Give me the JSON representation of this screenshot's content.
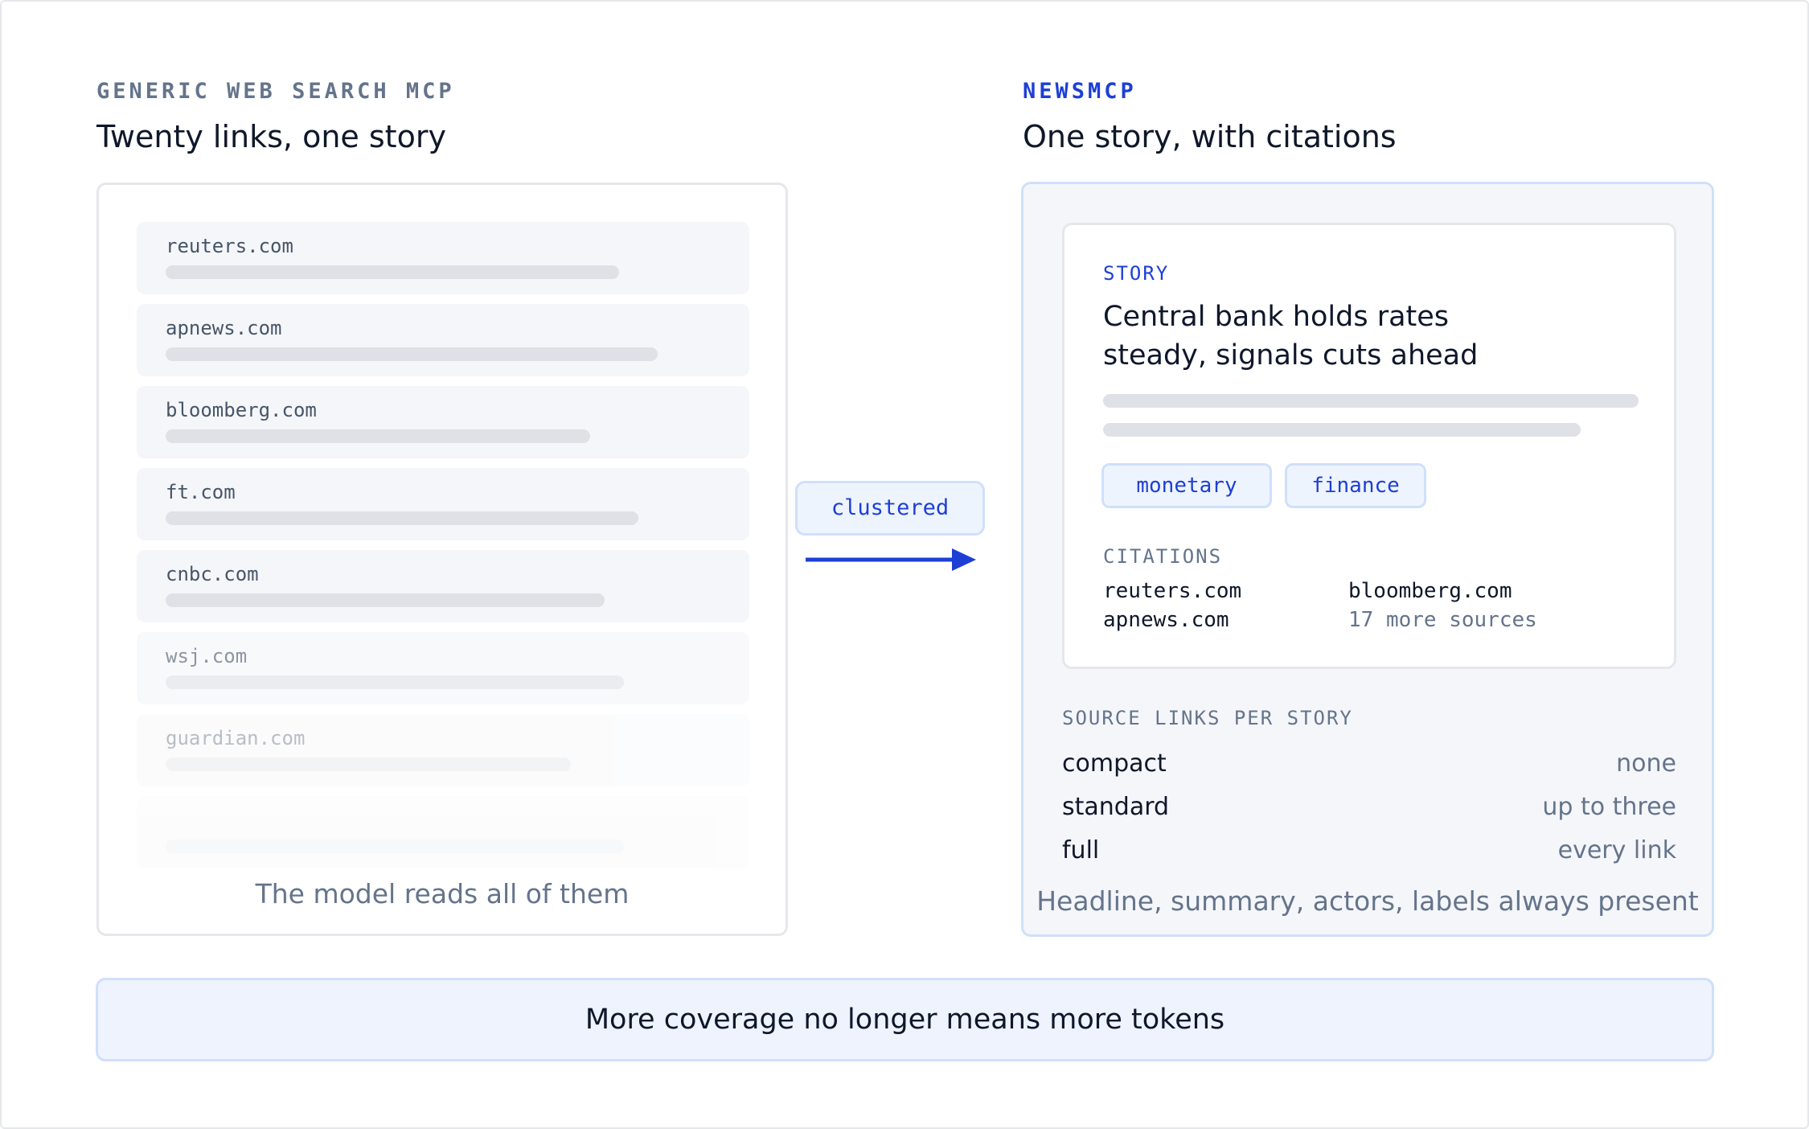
{
  "left": {
    "eyebrow": "GENERIC WEB SEARCH MCP",
    "heading": "Twenty links, one story",
    "results": [
      {
        "domain": "reuters.com"
      },
      {
        "domain": "apnews.com"
      },
      {
        "domain": "bloomberg.com"
      },
      {
        "domain": "ft.com"
      },
      {
        "domain": "cnbc.com"
      },
      {
        "domain": "wsj.com"
      },
      {
        "domain": "guardian.com"
      },
      {
        "domain": ""
      }
    ],
    "caption": "The model reads all of them"
  },
  "connector": {
    "label": "clustered",
    "arrow_color": "#1d3fd6"
  },
  "right": {
    "eyebrow": "NEWSMCP",
    "heading": "One story, with citations",
    "story": {
      "label": "STORY",
      "headline": "Central bank holds rates steady, signals cuts ahead",
      "tags": [
        "monetary",
        "finance"
      ],
      "citations_label": "CITATIONS",
      "citations": [
        "reuters.com",
        "bloomberg.com",
        "apnews.com"
      ],
      "more_sources": "17 more sources"
    },
    "levels_label": "SOURCE LINKS PER STORY",
    "levels": [
      {
        "name": "compact",
        "value": "none"
      },
      {
        "name": "standard",
        "value": "up to three"
      },
      {
        "name": "full",
        "value": "every link"
      }
    ],
    "caption": "Headline, summary, actors, labels always present"
  },
  "banner": "More coverage no longer means more tokens",
  "colors": {
    "accent": "#1d3fd6",
    "pill_bg": "#eef4fe",
    "pill_border": "#cfe0fb",
    "muted_text": "#64748b"
  }
}
